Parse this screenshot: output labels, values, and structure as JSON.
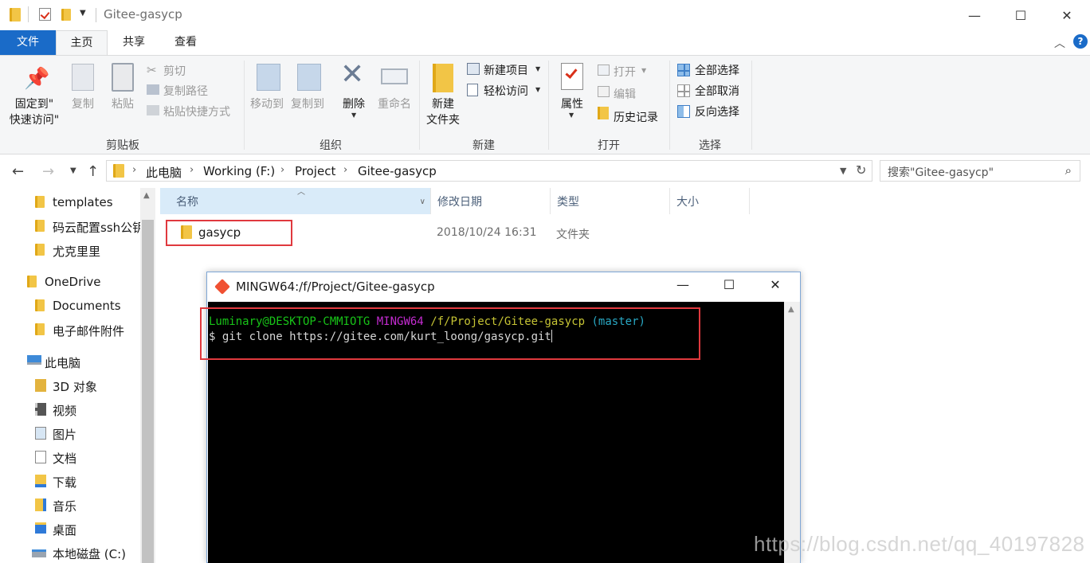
{
  "window": {
    "title": "Gitee-gasycp",
    "minimize": "—",
    "maximize": "☐",
    "close": "✕"
  },
  "ribbon_tabs": {
    "file": "文件",
    "home": "主页",
    "share": "共享",
    "view": "查看"
  },
  "ribbon": {
    "clipboard": {
      "label": "剪贴板",
      "pin_line1": "固定到\"",
      "pin_line2": "快速访问\"",
      "copy": "复制",
      "paste": "粘贴",
      "cut": "剪切",
      "copy_path": "复制路径",
      "paste_shortcut": "粘贴快捷方式"
    },
    "organize": {
      "label": "组织",
      "move_to": "移动到",
      "copy_to": "复制到",
      "delete": "删除",
      "rename": "重命名"
    },
    "new": {
      "label": "新建",
      "new_folder_line1": "新建",
      "new_folder_line2": "文件夹",
      "new_item": "新建项目",
      "easy_access": "轻松访问"
    },
    "open": {
      "label": "打开",
      "properties": "属性",
      "open": "打开",
      "edit": "编辑",
      "history": "历史记录"
    },
    "select": {
      "label": "选择",
      "select_all": "全部选择",
      "select_none": "全部取消",
      "invert": "反向选择"
    }
  },
  "address": {
    "crumbs": [
      "此电脑",
      "Working (F:)",
      "Project",
      "Gitee-gasycp"
    ],
    "search_placeholder": "搜索\"Gitee-gasycp\""
  },
  "nav_pane": {
    "items": [
      "templates",
      "码云配置ssh公钥",
      "尤克里里",
      "OneDrive",
      "Documents",
      "电子邮件附件",
      "此电脑",
      "3D 对象",
      "视频",
      "图片",
      "文档",
      "下载",
      "音乐",
      "桌面",
      "本地磁盘 (C:)"
    ]
  },
  "file_list": {
    "columns": [
      "名称",
      "修改日期",
      "类型",
      "大小"
    ],
    "rows": [
      {
        "name": "gasycp",
        "date": "2018/10/24 16:31",
        "type": "文件夹"
      }
    ]
  },
  "terminal": {
    "title": "MINGW64:/f/Project/Gitee-gasycp",
    "prompt_user": "Luminary@DESKTOP-CMMIOTG",
    "prompt_env": "MINGW64",
    "prompt_path": "/f/Project/Gitee-gasycp",
    "prompt_branch": "(master)",
    "command": "$ git clone https://gitee.com/kurt_loong/gasycp.git"
  },
  "watermark": "https://blog.csdn.net/qq_40197828",
  "colors": {
    "accent": "#1a6bc8",
    "highlight_box": "#e0393e",
    "terminal_bg": "#000000"
  }
}
